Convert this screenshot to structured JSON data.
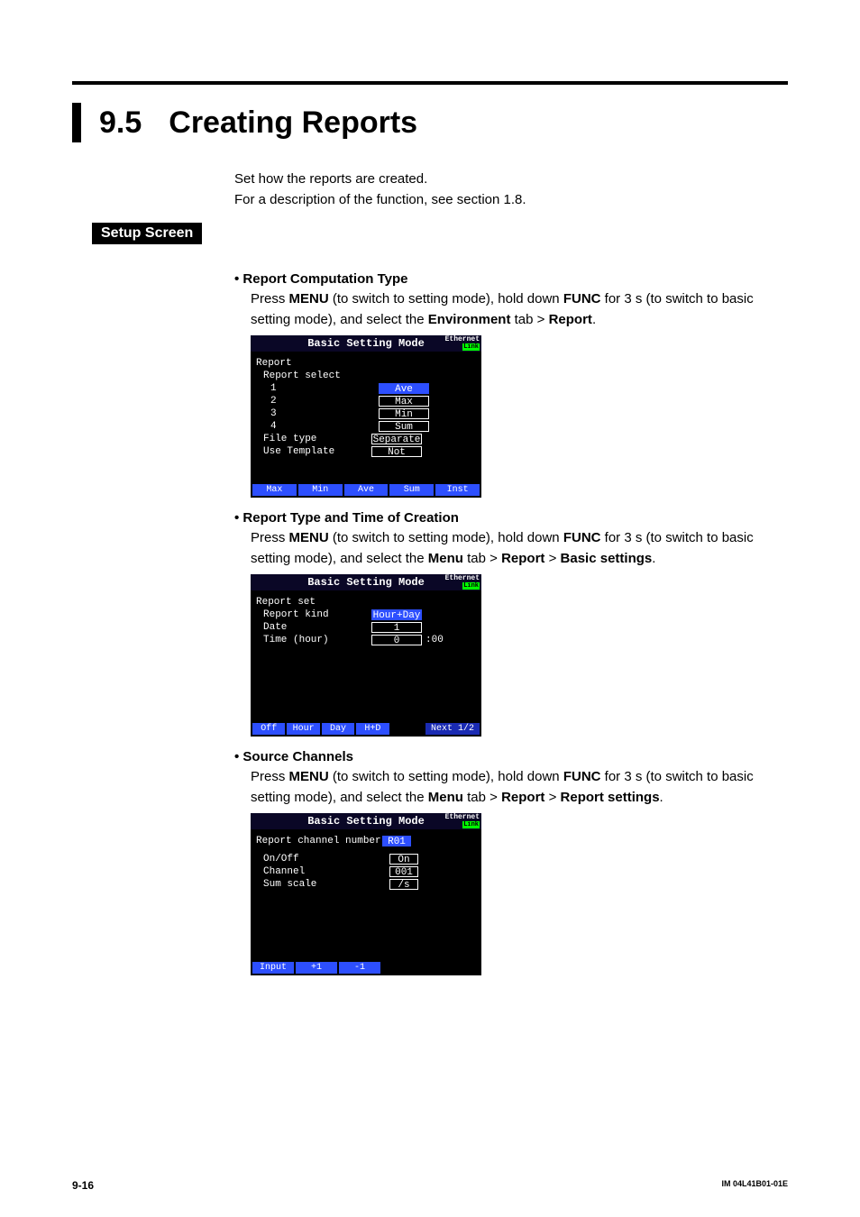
{
  "section": {
    "number": "9.5",
    "title": "Creating Reports"
  },
  "intro": {
    "line1": "Set how the reports are created.",
    "line2": "For a description of the function, see section 1.8."
  },
  "setup_label": "Setup Screen",
  "items": [
    {
      "heading": "Report Computation Type",
      "instr_pre": "Press ",
      "instr_menu": "MENU",
      "instr_mid1": " (to switch to setting mode), hold down ",
      "instr_func": "FUNC",
      "instr_mid2": " for 3 s (to switch to basic setting mode), and select the ",
      "tab": "Environment",
      "instr_post": " tab > ",
      "crumbs": [
        "Report"
      ],
      "instr_end": "."
    },
    {
      "heading": "Report Type and Time of Creation",
      "instr_pre": "Press ",
      "instr_menu": "MENU",
      "instr_mid1": " (to switch to setting mode), hold down ",
      "instr_func": "FUNC",
      "instr_mid2": " for 3 s (to switch to basic setting mode), and select the ",
      "tab": "Menu",
      "instr_post": " tab > ",
      "crumbs": [
        "Report",
        "Basic settings"
      ],
      "instr_end": "."
    },
    {
      "heading": "Source Channels",
      "instr_pre": "Press ",
      "instr_menu": "MENU",
      "instr_mid1": " (to switch to setting mode), hold down ",
      "instr_func": "FUNC",
      "instr_mid2": " for 3 s (to switch to basic setting mode), and select the ",
      "tab": "Menu",
      "instr_post": " tab > ",
      "crumbs": [
        "Report",
        "Report settings"
      ],
      "instr_end": "."
    }
  ],
  "shot_title": "Basic Setting Mode",
  "ethernet": "Ethernet",
  "link": "Link",
  "shot1": {
    "h1": "Report",
    "h2": "Report select",
    "rows": [
      {
        "label": "1",
        "value": "Ave",
        "sel": true
      },
      {
        "label": "2",
        "value": "Max"
      },
      {
        "label": "3",
        "value": "Min"
      },
      {
        "label": "4",
        "value": "Sum"
      },
      {
        "label": "File type",
        "value": "Separate",
        "noindent": true
      },
      {
        "label": "Use Template",
        "value": "Not",
        "noindent": true
      }
    ],
    "footer": [
      "Max",
      "Min",
      "Ave",
      "Sum",
      "Inst"
    ]
  },
  "shot2": {
    "h1": "Report set",
    "rows": [
      {
        "label": "Report kind",
        "value": "Hour+Day",
        "sel": true
      },
      {
        "label": "Date",
        "value": "1"
      },
      {
        "label": "Time (hour)",
        "value": "0",
        "extra": ":00"
      }
    ],
    "footer": [
      "Off",
      "Hour",
      "Day",
      "H+D"
    ],
    "footer_right": "Next 1/2"
  },
  "shot3": {
    "h1_l": "Report channel number",
    "h1_v": "R01",
    "rows": [
      {
        "label": "On/Off",
        "value": "On"
      },
      {
        "label": "Channel",
        "value": "001"
      },
      {
        "label": "Sum scale",
        "value": "/s"
      }
    ],
    "footer": [
      "Input",
      "+1",
      "-1"
    ]
  },
  "footer": {
    "page": "9-16",
    "doc": "IM 04L41B01-01E"
  }
}
